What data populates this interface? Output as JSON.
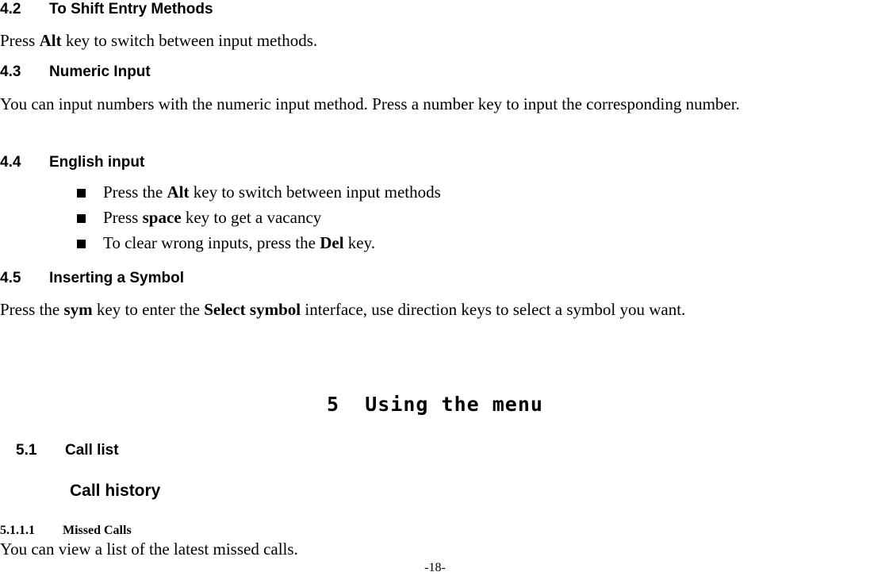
{
  "document": {
    "sections": [
      {
        "number": "4.2",
        "title": "To Shift Entry Methods",
        "paragraph_pre": "Press ",
        "paragraph_bold": "Alt",
        "paragraph_post": " key to switch between input methods."
      },
      {
        "number": "4.3",
        "title": "Numeric Input",
        "paragraph": "You can input numbers with the numeric input method. Press a number key to input the corresponding number."
      },
      {
        "number": "4.4",
        "title": "English input",
        "bullets": [
          {
            "pre": "Press the ",
            "bold": "Alt",
            "post": " key to switch between input methods"
          },
          {
            "pre": "Press ",
            "bold": "space",
            "post": " key to get a vacancy"
          },
          {
            "pre": "To clear wrong inputs, press the ",
            "bold": "Del",
            "post": " key."
          }
        ]
      },
      {
        "number": "4.5",
        "title": "Inserting a Symbol",
        "paragraph_pre": "Press the ",
        "paragraph_bold1": "sym",
        "paragraph_mid": " key to enter the ",
        "paragraph_bold2": "Select symbol",
        "paragraph_post": " interface, use direction keys to select a symbol you want."
      }
    ],
    "chapter": {
      "number": "5",
      "title": "Using the menu"
    },
    "subsection": {
      "number": "5.1",
      "title": "Call list",
      "sub_title": "Call history",
      "item_number": "5.1.1.1",
      "item_title": "Missed Calls",
      "item_text": "You can view a list of the latest missed calls."
    },
    "footer": {
      "page_label": "-18-"
    }
  }
}
